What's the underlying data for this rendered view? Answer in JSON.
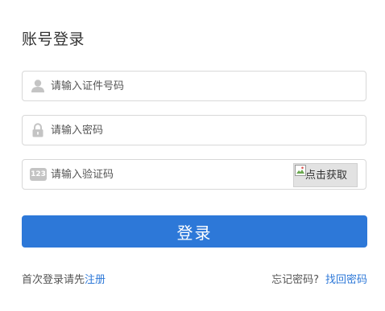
{
  "title": "账号登录",
  "fields": {
    "id_number": {
      "placeholder": "请输入证件号码",
      "value": "",
      "icon": "user-icon"
    },
    "password": {
      "placeholder": "请输入密码",
      "value": "",
      "icon": "lock-icon"
    },
    "captcha": {
      "placeholder": "请输入验证码",
      "value": "",
      "icon": "captcha-123-icon",
      "icon_text": "123"
    }
  },
  "captcha_button": {
    "label": "点击获取"
  },
  "login_button": {
    "label": "登录"
  },
  "footer": {
    "first_login_text": "首次登录请先",
    "register_link": "注册",
    "forgot_text": "忘记密码?",
    "recover_link": "找回密码"
  },
  "colors": {
    "primary": "#2d78d8",
    "border": "#d8d8d8",
    "icon": "#c4c4c4"
  }
}
